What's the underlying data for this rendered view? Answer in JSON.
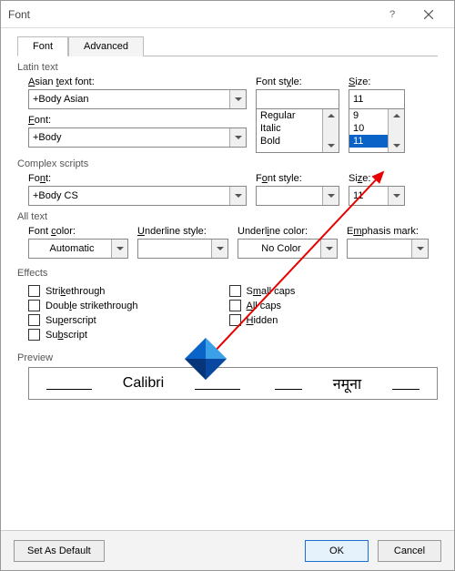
{
  "title": "Font",
  "tabs": {
    "font": "Font",
    "advanced": "Advanced"
  },
  "latin": {
    "section": "Latin text",
    "asian_font_label": "Asian text font:",
    "asian_font_value": "+Body Asian",
    "font_label": "Font:",
    "font_value": "+Body",
    "fontstyle_label": "Font style:",
    "fontstyle_value": "",
    "fontstyle_items": [
      "Regular",
      "Italic",
      "Bold"
    ],
    "size_label": "Size:",
    "size_value": "11",
    "size_items": [
      "9",
      "10",
      "11"
    ]
  },
  "complex": {
    "section": "Complex scripts",
    "font_label": "Font:",
    "font_value": "+Body CS",
    "fontstyle_label": "Font style:",
    "fontstyle_value": "",
    "size_label": "Size:",
    "size_value": "11"
  },
  "alltext": {
    "section": "All text",
    "fontcolor_label": "Font color:",
    "fontcolor_value": "Automatic",
    "ustyle_label": "Underline style:",
    "ustyle_value": "",
    "ucolor_label": "Underline color:",
    "ucolor_value": "No Color",
    "emark_label": "Emphasis mark:",
    "emark_value": ""
  },
  "effects": {
    "section": "Effects",
    "strike": "Strikethrough",
    "dstrike": "Double strikethrough",
    "super": "Superscript",
    "sub": "Subscript",
    "smallcaps": "Small caps",
    "allcaps": "All caps",
    "hidden": "Hidden"
  },
  "preview": {
    "section": "Preview",
    "latin": "Calibri",
    "cs": "नमूना"
  },
  "buttons": {
    "default": "Set As Default",
    "ok": "OK",
    "cancel": "Cancel"
  }
}
